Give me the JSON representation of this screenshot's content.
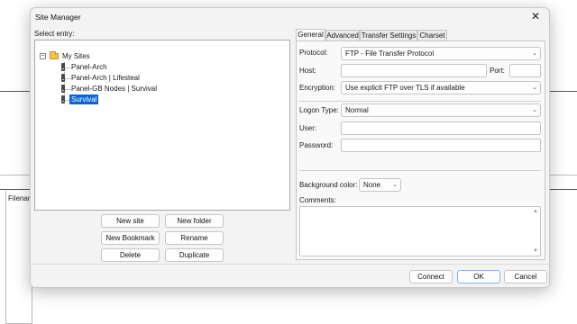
{
  "background": {
    "filename_label": "Filenan"
  },
  "dialog": {
    "title": "Site Manager",
    "close_glyph": "✕"
  },
  "entries": {
    "label": "Select entry:",
    "root": {
      "label": "My Sites",
      "toggle": "−",
      "icon": "folder-icon"
    },
    "sites": [
      {
        "label": "Panel-Arch",
        "icon": "server-icon"
      },
      {
        "label": "Panel-Arch | Lifesteal",
        "icon": "server-icon"
      },
      {
        "label": "Panel-GB Nodes | Survival",
        "icon": "server-icon"
      },
      {
        "label": "Survival",
        "icon": "server-icon",
        "selected": true
      }
    ]
  },
  "buttons": {
    "new_site": "New site",
    "new_folder": "New folder",
    "new_bookmark": "New Bookmark",
    "rename": "Rename",
    "delete": "Delete",
    "duplicate": "Duplicate"
  },
  "tabs": [
    {
      "label": "General",
      "active": true
    },
    {
      "label": "Advanced",
      "active": false
    },
    {
      "label": "Transfer Settings",
      "active": false
    },
    {
      "label": "Charset",
      "active": false
    }
  ],
  "general": {
    "protocol_label": "Protocol:",
    "protocol_value": "FTP - File Transfer Protocol",
    "host_label": "Host:",
    "host_value": "",
    "port_label": "Port:",
    "port_value": "",
    "encryption_label": "Encryption:",
    "encryption_value": "Use explicit FTP over TLS if available",
    "logon_label": "Logon Type:",
    "logon_value": "Normal",
    "user_label": "User:",
    "user_value": "",
    "password_label": "Password:",
    "password_value": "",
    "bgcolor_label": "Background color:",
    "bgcolor_value": "None",
    "comments_label": "Comments:",
    "comments_value": ""
  },
  "footer": {
    "connect": "Connect",
    "ok": "OK",
    "cancel": "Cancel"
  },
  "colors": {
    "selection": "#0a64d6",
    "folder": "#f2c24f"
  }
}
